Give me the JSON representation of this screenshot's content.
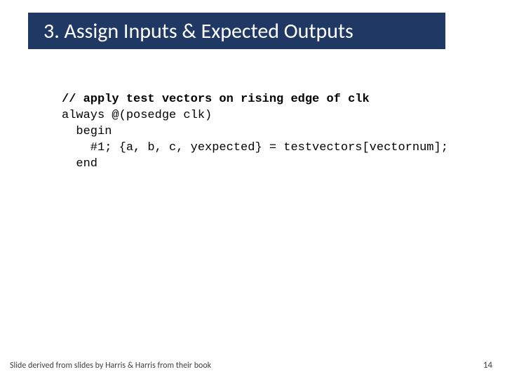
{
  "header": {
    "title": "3. Assign Inputs & Expected Outputs"
  },
  "code": {
    "comment": "// apply test vectors on rising edge of clk",
    "line1": "always @(posedge clk)",
    "line2": "  begin",
    "line3": "    #1; {a, b, c, yexpected} = testvectors[vectornum];",
    "line4": "  end"
  },
  "footer": {
    "attribution": "Slide derived from slides by Harris & Harris from their book",
    "page_number": "14"
  }
}
